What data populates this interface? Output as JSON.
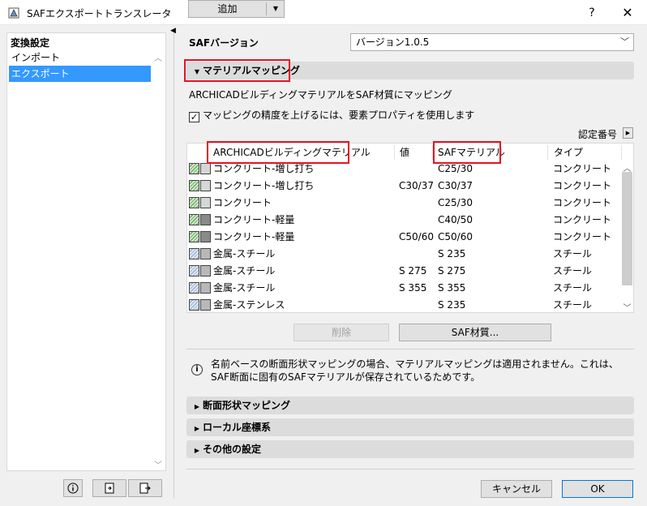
{
  "window": {
    "title": "SAFエクスポートトランスレータ",
    "help": "?",
    "close": "✕"
  },
  "sidebar": {
    "header": "変換設定",
    "items": [
      {
        "label": "インポート"
      },
      {
        "label": "エクスポート"
      }
    ]
  },
  "saf_version": {
    "label": "SAFバージョン",
    "value": "バージョン1.0.5"
  },
  "material_mapping": {
    "title": "マテリアルマッピング",
    "description": "ARCHICADビルディングマテリアルをSAF材質にマッピング",
    "checkbox_label": "マッピングの精度を上げるには、要素プロパティを使用します",
    "checkbox_checked": true,
    "cert_label": "認定番号",
    "columns": [
      "ARCHICADビルディングマテリアル",
      "値",
      "SAFマテリアル",
      "タイプ"
    ],
    "rows": [
      {
        "swatch": "concrete",
        "material": "コンクリート-増し打ち",
        "value": "",
        "saf": "C25/30",
        "type": "コンクリート"
      },
      {
        "swatch": "concrete",
        "material": "コンクリート-増し打ち",
        "value": "C30/37",
        "saf": "C30/37",
        "type": "コンクリート"
      },
      {
        "swatch": "concrete",
        "material": "コンクリート",
        "value": "",
        "saf": "C25/30",
        "type": "コンクリート"
      },
      {
        "swatch": "concrete-dark",
        "material": "コンクリート-軽量",
        "value": "",
        "saf": "C40/50",
        "type": "コンクリート"
      },
      {
        "swatch": "concrete-dark",
        "material": "コンクリート-軽量",
        "value": "C50/60",
        "saf": "C50/60",
        "type": "コンクリート"
      },
      {
        "swatch": "steel",
        "material": "金属-スチール",
        "value": "",
        "saf": "S 235",
        "type": "スチール"
      },
      {
        "swatch": "steel",
        "material": "金属-スチール",
        "value": "S 275",
        "saf": "S 275",
        "type": "スチール"
      },
      {
        "swatch": "steel",
        "material": "金属-スチール",
        "value": "S 355",
        "saf": "S 355",
        "type": "スチール"
      },
      {
        "swatch": "steel",
        "material": "金属-ステンレス",
        "value": "",
        "saf": "S 235",
        "type": "スチール"
      }
    ],
    "buttons": {
      "add": "追加",
      "delete": "削除",
      "saf_material": "SAF材質..."
    },
    "info": "名前ベースの断面形状マッピングの場合、マテリアルマッピングは適用されません。これは、SAF断面に固有のSAFマテリアルが保存されているためです。"
  },
  "sections": [
    {
      "title": "断面形状マッピング"
    },
    {
      "title": "ローカル座標系"
    },
    {
      "title": "その他の設定"
    }
  ],
  "footer": {
    "cancel": "キャンセル",
    "ok": "OK"
  },
  "colors": {
    "selection": "#3399ff",
    "highlight": "#e81123",
    "section_bar": "#dcdcdc"
  }
}
